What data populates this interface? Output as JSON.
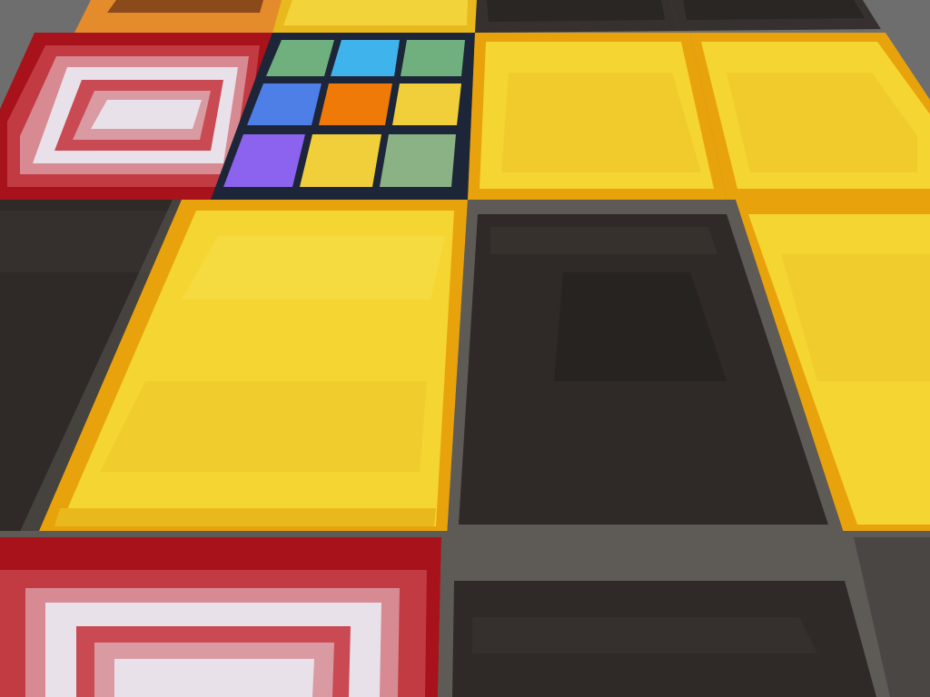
{
  "scene": {
    "type": "first-person view of a block floor",
    "hud_visible": false,
    "block_types": [
      "gold-block",
      "blackstone-block",
      "red-concentric-block",
      "colored-grid-block",
      "orange-block"
    ]
  },
  "colors": {
    "background": "#6e6e6e",
    "gold_light": "#f5d532",
    "gold_mid": "#e9b81d",
    "gold_edge": "#e8a30c",
    "gold_dark": "#d18908",
    "blackstone": "#2f2a27",
    "blackstone_light": "#3a3532",
    "blackstone_edge": "#5e5a56",
    "red_outer": "#a8121a",
    "red_mid": "#c23a42",
    "red_pale": "#d88a92",
    "white_pale": "#e8e1ea",
    "grid_frame": "#1d2538",
    "grid_green": "#6fb07e",
    "grid_cyan": "#3fb4ec",
    "grid_blue": "#4e7fe6",
    "grid_orange": "#ef7a07",
    "grid_yellow": "#f1cf3a",
    "grid_purple": "#8c63ee",
    "grid_sage": "#8bb285",
    "orange_block": "#e48c2c"
  }
}
